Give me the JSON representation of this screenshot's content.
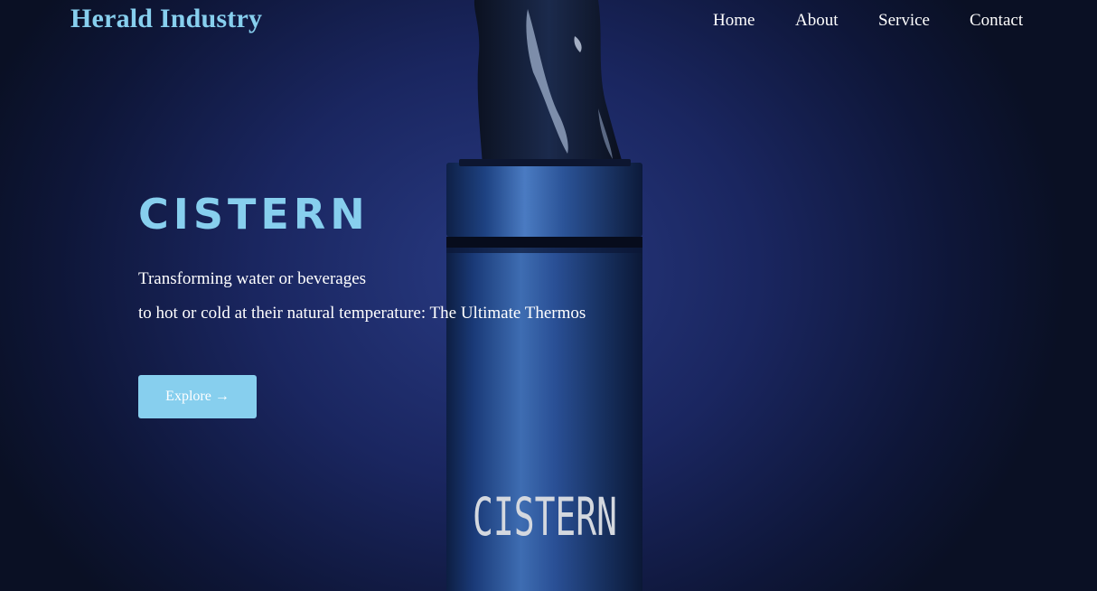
{
  "brand": {
    "name": "Herald Industry",
    "color": "#87cfee"
  },
  "nav": {
    "items": [
      {
        "label": "Home"
      },
      {
        "label": "About"
      },
      {
        "label": "Service"
      },
      {
        "label": "Contact"
      }
    ]
  },
  "hero": {
    "title": "CISTERN",
    "line1": "Transforming water or beverages",
    "line2": "to hot or cold at their natural temperature: The Ultimate Thermos",
    "button_label": "Explore",
    "button_icon": "arrow-right-icon",
    "button_icon_glyph": "→",
    "product_label": "CISTERN"
  },
  "colors": {
    "accent": "#87cfee",
    "background": "#1a2660",
    "text": "#ffffff"
  }
}
